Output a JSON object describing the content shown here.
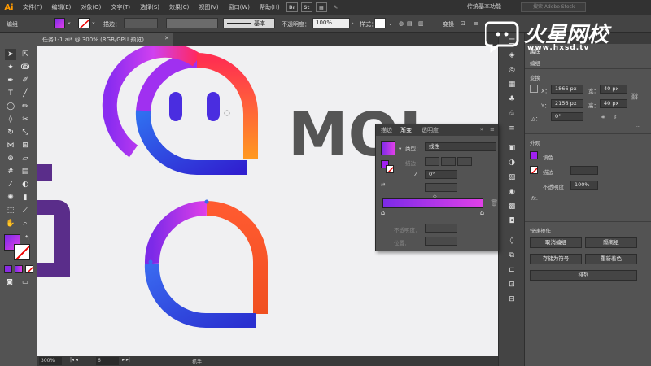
{
  "app": {
    "logo": "Ai"
  },
  "menu": [
    "文件(F)",
    "编辑(E)",
    "对象(O)",
    "文字(T)",
    "选择(S)",
    "效果(C)",
    "视图(V)",
    "窗口(W)",
    "帮助(H)"
  ],
  "menubar_icons": [
    "Br",
    "St"
  ],
  "workspace": "传统基本功能",
  "search_placeholder": "搜索 Adobe Stock",
  "control_bar": {
    "group_label": "编组",
    "stroke_label": "描边：",
    "stroke_style": "基本",
    "opacity_label": "不透明度：",
    "opacity_value": "100%",
    "style_label": "样式：",
    "transform_label": "变换"
  },
  "document_tab": "任务1-1.ai* @ 300% (RGB/GPU 预览)",
  "status_bar": {
    "zoom": "300%",
    "page": "6",
    "tool": "抓手"
  },
  "canvas": {
    "text_partial": "MOI"
  },
  "gradient_panel": {
    "tabs": [
      "描边",
      "渐变",
      "透明度"
    ],
    "type_label": "类型：",
    "type_value": "线性",
    "stroke_label": "描边：",
    "angle_value": "0°",
    "opacity_label": "不透明度：",
    "position_label": "位置："
  },
  "properties_panel": {
    "title": "属性",
    "group_label": "编组",
    "transform_title": "变换",
    "x_label": "X：",
    "x_value": "1866 px",
    "y_label": "Y：",
    "y_value": "2156 px",
    "w_label": "宽：",
    "w_value": "40 px",
    "h_label": "高：",
    "h_value": "40 px",
    "rotate_label": "△：",
    "rotate_value": "0°",
    "appearance_title": "外观",
    "fill_label": "填色",
    "stroke_label": "描边",
    "opacity_label": "不透明度",
    "opacity_value": "100%",
    "fx_label": "fx.",
    "quick_actions_title": "快速操作",
    "btn_ungroup": "取消编组",
    "btn_isolate": "隔离组",
    "btn_save_symbol": "存储为符号",
    "btn_recolor": "重新着色",
    "btn_arrange": "排列"
  },
  "watermark": {
    "brand": "火星网校",
    "url": "www.hxsd.tv"
  },
  "colors": {
    "accent_purple": "#a020f0",
    "gradient_start": "#7c2ae8",
    "gradient_end": "#e040e8",
    "orange": "#ff6a28",
    "blue": "#2a40d8"
  }
}
